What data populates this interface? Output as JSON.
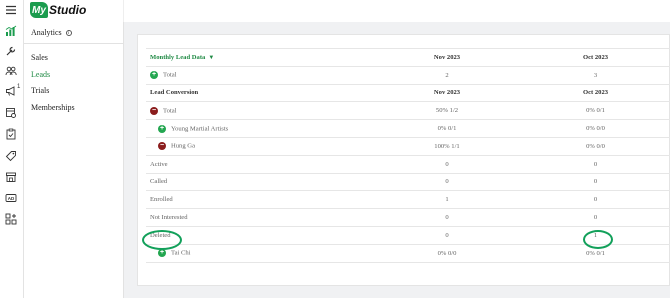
{
  "app": {
    "logo_badge": "My",
    "logo_word": "Studio"
  },
  "rail": {
    "icons": [
      "menu-icon",
      "bar-chart-icon",
      "wrench-icon",
      "users-icon",
      "megaphone-icon",
      "settings-page-icon",
      "clipboard-icon",
      "tag-icon",
      "store-icon",
      "ad-icon",
      "apps-icon"
    ],
    "megaphone_badge": "1"
  },
  "subnav": {
    "title": "Analytics",
    "info": "i",
    "items": [
      {
        "label": "Sales",
        "active": false
      },
      {
        "label": "Leads",
        "active": true
      },
      {
        "label": "Trials",
        "active": false
      },
      {
        "label": "Memberships",
        "active": false
      }
    ]
  },
  "table": {
    "section1": {
      "dropdown_label": "Monthly Lead Data",
      "col2": "Nov 2023",
      "col3": "Oct 2023"
    },
    "total1": {
      "label": "Total",
      "col2": "2",
      "col3": "3"
    },
    "section2": {
      "label": "Lead Conversion",
      "col2": "Nov 2023",
      "col3": "Oct 2023"
    },
    "rows": [
      {
        "label": "Total",
        "col2": "50% 1/2",
        "col3": "0% 0/1"
      },
      {
        "label": "Young Martial Artists",
        "col2": "0% 0/1",
        "col3": "0% 0/0"
      },
      {
        "label": "Hung Ga",
        "col2": "100% 1/1",
        "col3": "0% 0/0"
      },
      {
        "label": "Active",
        "col2": "0",
        "col3": "0"
      },
      {
        "label": "Called",
        "col2": "0",
        "col3": "0"
      },
      {
        "label": "Enrolled",
        "col2": "1",
        "col3": "0"
      },
      {
        "label": "Not Interested",
        "col2": "0",
        "col3": "0"
      },
      {
        "label": "Deleted",
        "col2": "0",
        "col3": "1"
      },
      {
        "label": "Tai Chi",
        "col2": "0% 0/0",
        "col3": "0% 0/1"
      }
    ]
  },
  "colors": {
    "brand_green": "#1b9c4e",
    "expand_green": "#23a650",
    "collapse_red": "#8b1d1d",
    "highlight_green": "#12a05a"
  }
}
